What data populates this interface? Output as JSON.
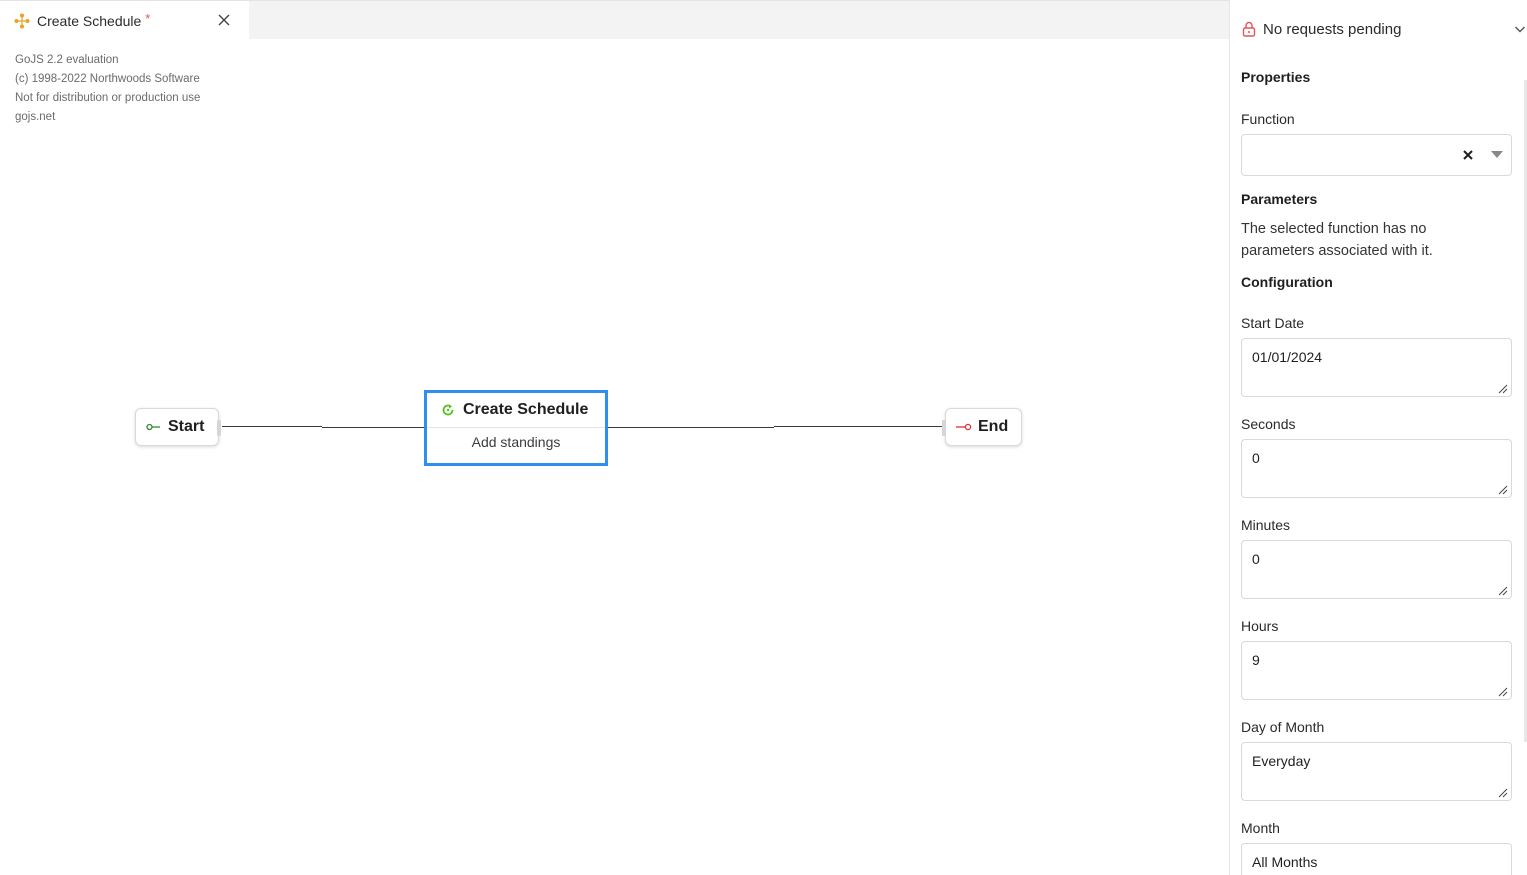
{
  "tab": {
    "label": "Create Schedule",
    "dirty_marker": "*",
    "icon": "workflow-icon",
    "close_icon": "close-icon"
  },
  "canvas": {
    "watermark": [
      "GoJS 2.2 evaluation",
      "(c) 1998-2022 Northwoods Software",
      "Not for distribution or production use",
      "gojs.net"
    ],
    "nodes": {
      "start": {
        "label": "Start",
        "icon": "start-icon",
        "icon_color": "#2e8b2e"
      },
      "main": {
        "title": "Create Schedule",
        "subtitle": "Add standings",
        "icon": "refresh-icon",
        "icon_color": "#52c41a",
        "selected": true,
        "border_color": "#2f8fee"
      },
      "end": {
        "label": "End",
        "icon": "end-icon",
        "icon_color": "#e03030"
      }
    }
  },
  "panel": {
    "status": {
      "text": "No requests pending",
      "icon": "lock-icon",
      "icon_color": "#e25555",
      "expand_icon": "chevron-down-icon"
    },
    "properties_title": "Properties",
    "function": {
      "label": "Function",
      "value": ""
    },
    "parameters": {
      "title": "Parameters",
      "description": "The selected function has no parameters associated with it."
    },
    "configuration": {
      "title": "Configuration",
      "fields": [
        {
          "label": "Start Date",
          "value": "01/01/2024"
        },
        {
          "label": "Seconds",
          "value": "0"
        },
        {
          "label": "Minutes",
          "value": "0"
        },
        {
          "label": "Hours",
          "value": "9"
        },
        {
          "label": "Day of Month",
          "value": "Everyday"
        },
        {
          "label": "Month",
          "value": "All Months"
        }
      ]
    }
  }
}
